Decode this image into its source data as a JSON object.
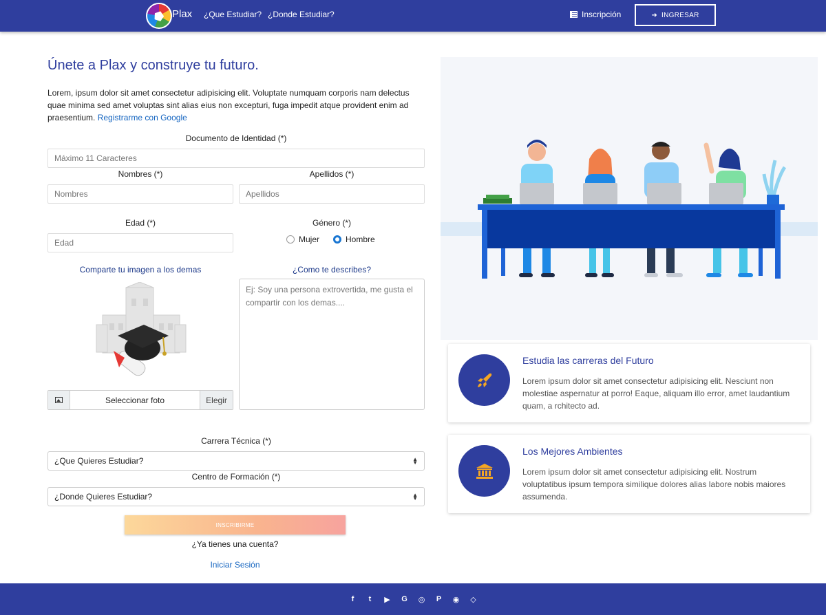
{
  "nav": {
    "brand": "Plax",
    "link1": "¿Que Estudiar?",
    "link2": "¿Donde Estudiar?",
    "register": "Inscripción",
    "login": "INGRESAR"
  },
  "form": {
    "title": "Únete a Plax y construye tu futuro.",
    "intro": "Lorem, ipsum dolor sit amet consectetur adipisicing elit. Voluptate numquam corporis nam delectus quae minima sed amet voluptas sint alias eius non excepturi, fuga impedit atque provident enim ad praesentium.",
    "google_link": "Registrarme con Google",
    "doc_label": "Documento de Identidad (*)",
    "doc_placeholder": "Máximo 11 Caracteres",
    "names_label": "Nombres (*)",
    "names_placeholder": "Nombres",
    "surnames_label": "Apellidos (*)",
    "surnames_placeholder": "Apellidos",
    "age_label": "Edad (*)",
    "age_placeholder": "Edad",
    "gender_label": "Género (*)",
    "gender_female": "Mujer",
    "gender_male": "Hombre",
    "photo_label": "Comparte tu imagen a los demas",
    "file_text": "Seleccionar foto",
    "file_button": "Elegir",
    "describe_label": "¿Como te describes?",
    "describe_placeholder": "Ej: Soy una persona extrovertida, me gusta el compartir con los demas....",
    "career_label": "Carrera Técnica (*)",
    "career_value": "¿Que Quieres Estudiar?",
    "center_label": "Centro de Formación (*)",
    "center_value": "¿Donde Quieres Estudiar?",
    "submit": "INSCRIBIRME",
    "have_account": "¿Ya tienes una cuenta?",
    "login_link": "Iniciar Sesión"
  },
  "features": [
    {
      "title": "Estudia las carreras del Futuro",
      "text": "Lorem ipsum dolor sit amet consectetur adipisicing elit. Nesciunt non molestiae aspernatur at porro! Eaque, aliquam illo error, amet laudantium quam, a rchitecto ad.",
      "icon": "rocket-icon"
    },
    {
      "title": "Los Mejores Ambientes",
      "text": "Lorem ipsum dolor sit amet consectetur adipisicing elit. Nostrum voluptatibus ipsum tempora similique dolores alias labore nobis maiores assumenda.",
      "icon": "institution-icon"
    }
  ],
  "footer": {
    "icons": [
      "facebook-icon",
      "twitter-icon",
      "youtube-icon",
      "google-plus-icon",
      "dribbble-icon",
      "pinterest-icon",
      "github-icon",
      "codepen-icon"
    ]
  },
  "colors": {
    "primary": "#2f3e9e",
    "accent_orange": "#f5a623",
    "link": "#1565c0"
  }
}
